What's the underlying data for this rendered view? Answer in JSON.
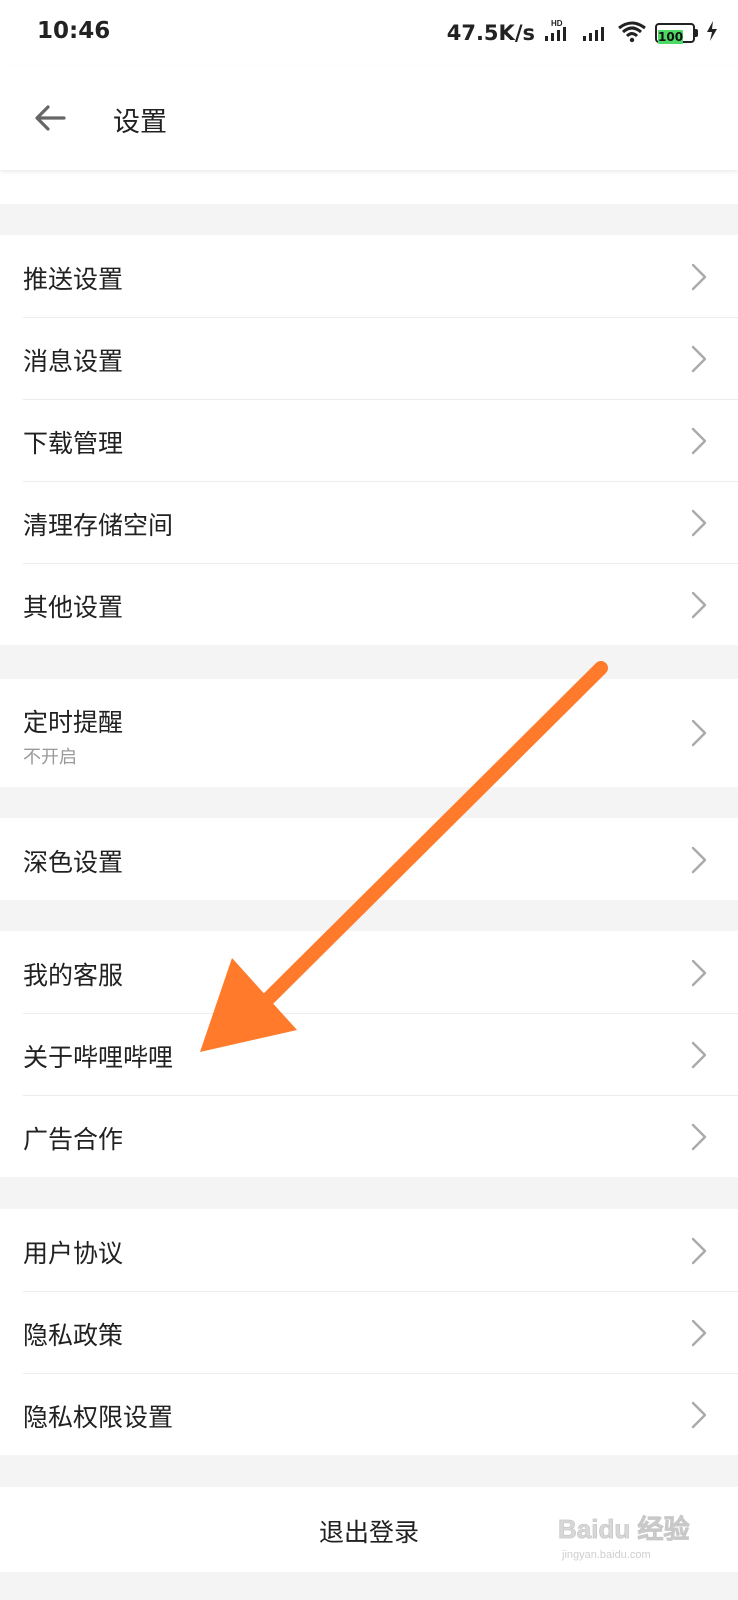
{
  "status_bar": {
    "time": "10:46",
    "net_speed": "47.5K/s",
    "network_badge": "HD",
    "battery_level": "100",
    "icons": [
      "signal-icon",
      "signal-icon",
      "wifi-icon",
      "battery-icon",
      "charging-icon"
    ]
  },
  "header": {
    "back_icon": "back-arrow-icon",
    "title": "设置"
  },
  "groups": [
    {
      "items": [
        {
          "label": "推送设置"
        },
        {
          "label": "消息设置"
        },
        {
          "label": "下载管理"
        },
        {
          "label": "清理存储空间"
        },
        {
          "label": "其他设置"
        }
      ]
    },
    {
      "items": [
        {
          "label": "定时提醒",
          "sub": "不开启"
        }
      ]
    },
    {
      "items": [
        {
          "label": "深色设置"
        }
      ]
    },
    {
      "items": [
        {
          "label": "我的客服"
        },
        {
          "label": "关于哔哩哔哩"
        },
        {
          "label": "广告合作"
        }
      ]
    },
    {
      "items": [
        {
          "label": "用户协议"
        },
        {
          "label": "隐私政策"
        },
        {
          "label": "隐私权限设置"
        }
      ]
    }
  ],
  "logout_label": "退出登录",
  "colors": {
    "accent_arrow": "#ff7a2a",
    "battery_fill": "#4cd964",
    "divider": "#ececec",
    "background": "#f4f4f4"
  },
  "watermark": {
    "text": "Baidu 经验",
    "sub": "jingyan.baidu.com"
  }
}
